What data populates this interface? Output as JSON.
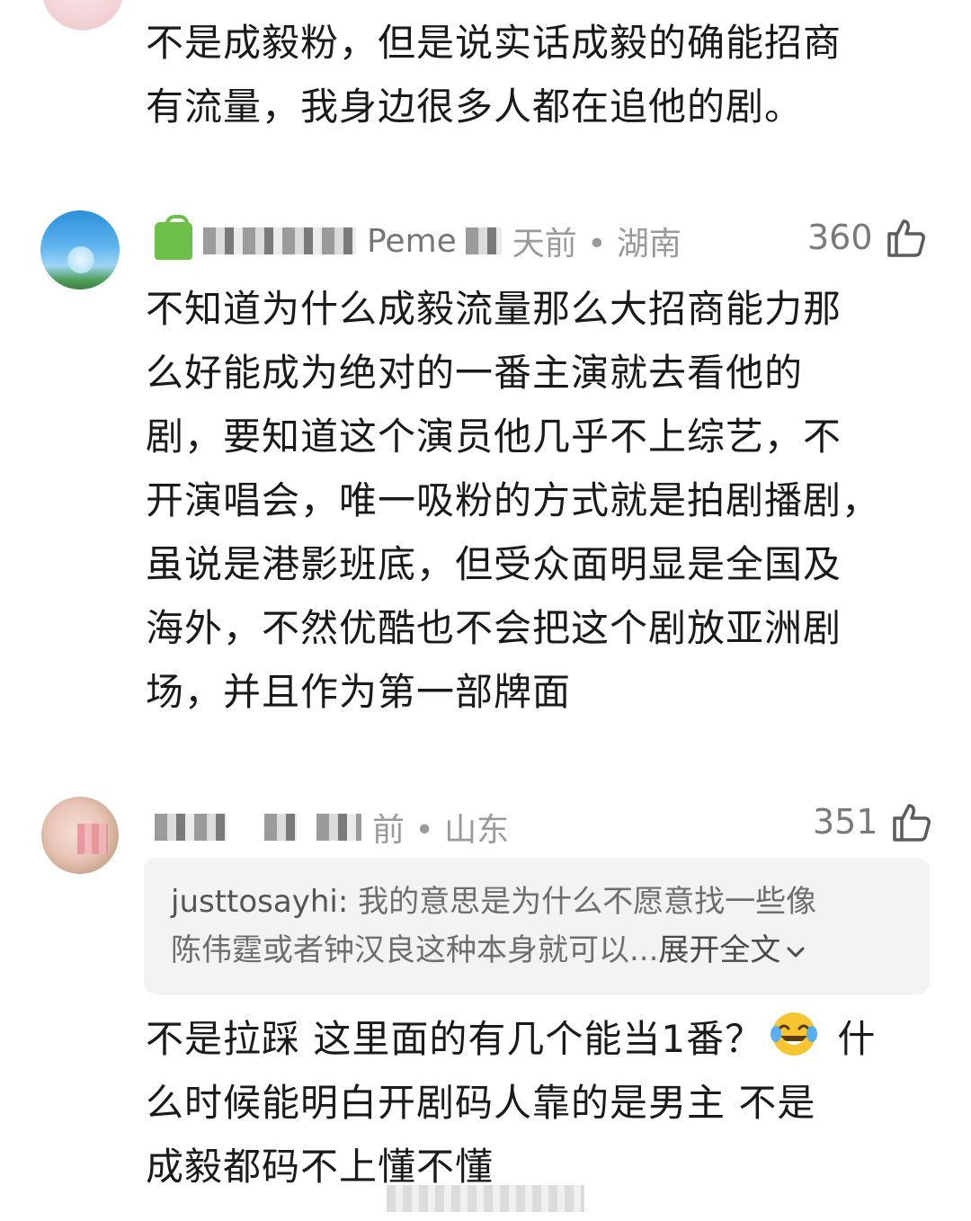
{
  "comments": [
    {
      "text": "不是成毅粉，但是说实话成毅的确能招商\n有流量，我身边很多人都在追他的剧。"
    },
    {
      "meta": "天前 • 湖南",
      "username_partial": "Peme",
      "likes": "360",
      "text": "不知道为什么成毅流量那么大招商能力那\n么好能成为绝对的一番主演就去看他的\n剧，要知道这个演员他几乎不上综艺，不\n开演唱会，唯一吸粉的方式就是拍剧播剧，\n虽说是港影班底，但受众面明显是全国及\n海外，不然优酷也不会把这个剧放亚洲剧\n场，并且作为第一部牌面"
    },
    {
      "meta": "前 • 山东",
      "likes": "351",
      "quote": {
        "name": "justtosayhi:",
        "text": " 我的意思是为什么不愿意找一些像\n陈伟霆或者钟汉良这种本身就可以...",
        "expand": "展开全文"
      },
      "text_a": "不是拉踩 这里面的有几个能当1番？",
      "emoji": "laughing-tears-emoji",
      "text_b": " 什\n么时候能明白开剧码人靠的是男主 不是\n成毅都码不上懂不懂"
    }
  ]
}
